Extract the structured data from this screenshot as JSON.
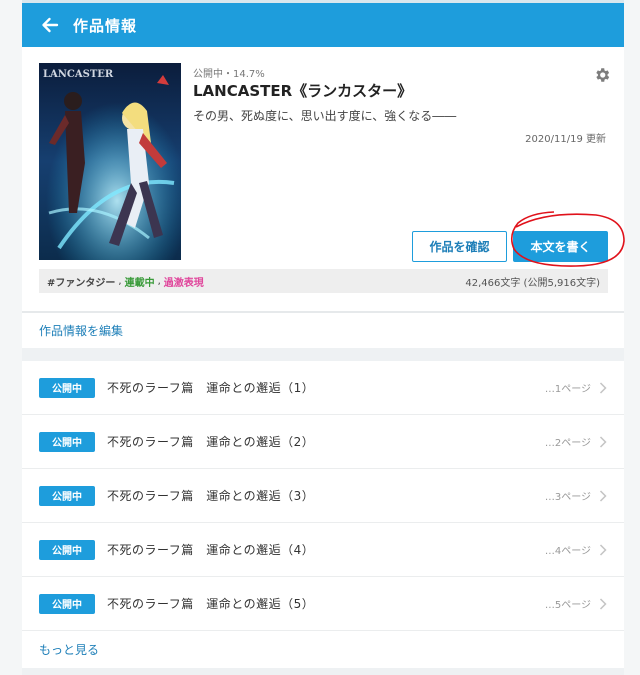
{
  "header": {
    "title": "作品情報",
    "back_icon": "arrow-left-icon"
  },
  "work": {
    "cover_logo": "LANCASTER",
    "status": "公開中・14.7%",
    "title": "LANCASTER《ランカスター》",
    "catchphrase": "その男、死ぬ度に、思い出す度に、強くなる――",
    "updated": "2020/11/19 更新",
    "settings_icon": "gear-icon"
  },
  "actions": {
    "confirm_label": "作品を確認",
    "write_label": "本文を書く"
  },
  "tags": {
    "genre": "#ファンタジー",
    "separator": ",",
    "serial": "連載中",
    "violence": "過激表現",
    "char_count": "42,466文字 (公開5,916文字)"
  },
  "edit": {
    "label": "作品情報を編集"
  },
  "episodes": [
    {
      "badge": "公開中",
      "title": "不死のラーフ篇　運命との邂逅（1）",
      "pages": "…1ページ"
    },
    {
      "badge": "公開中",
      "title": "不死のラーフ篇　運命との邂逅（2）",
      "pages": "…2ページ"
    },
    {
      "badge": "公開中",
      "title": "不死のラーフ篇　運命との邂逅（3）",
      "pages": "…3ページ"
    },
    {
      "badge": "公開中",
      "title": "不死のラーフ篇　運命との邂逅（4）",
      "pages": "…4ページ"
    },
    {
      "badge": "公開中",
      "title": "不死のラーフ篇　運命との邂逅（5）",
      "pages": "…5ページ"
    }
  ],
  "more": {
    "label": "もっと見る"
  },
  "colors": {
    "accent": "#1e9ddc",
    "serial": "#3a9b3a",
    "violence": "#e0479c",
    "annotation": "#e0121b"
  }
}
